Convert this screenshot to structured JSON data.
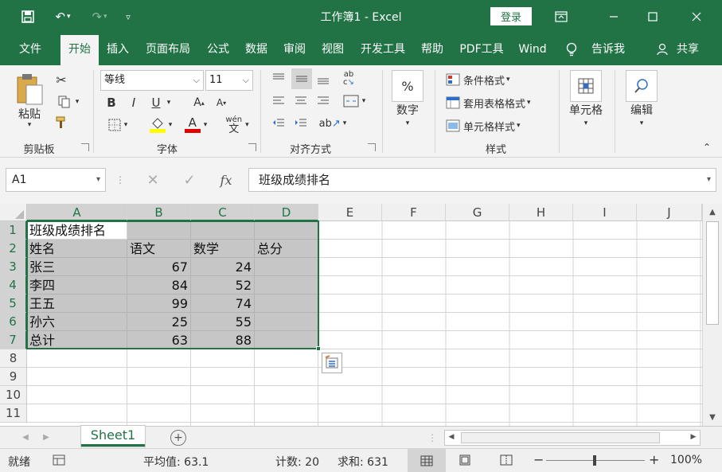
{
  "window": {
    "title": "工作簿1 - Excel",
    "login_label": "登录",
    "accent": "#217346"
  },
  "tabs": [
    {
      "label": "文件"
    },
    {
      "label": "开始",
      "active": true
    },
    {
      "label": "插入"
    },
    {
      "label": "页面布局"
    },
    {
      "label": "公式"
    },
    {
      "label": "数据"
    },
    {
      "label": "审阅"
    },
    {
      "label": "视图"
    },
    {
      "label": "开发工具"
    },
    {
      "label": "帮助"
    },
    {
      "label": "PDF工具"
    },
    {
      "label": "Wind"
    },
    {
      "label": "告诉我"
    },
    {
      "label": "共享"
    }
  ],
  "ribbon": {
    "clipboard": {
      "label": "剪贴板",
      "paste": "粘贴"
    },
    "font": {
      "label": "字体",
      "font_name": "等线",
      "font_size": "11",
      "bold": "B",
      "italic": "I",
      "underline": "U",
      "phonetic": "wén"
    },
    "alignment": {
      "label": "对齐方式"
    },
    "number": {
      "label": "数字",
      "symbol": "%"
    },
    "styles": {
      "label": "样式",
      "conditional": "条件格式",
      "table_format": "套用表格格式",
      "cell_styles": "单元格样式"
    },
    "cells": {
      "label": "单元格"
    },
    "editing": {
      "label": "编辑"
    }
  },
  "formula_bar": {
    "name_box": "A1",
    "fx": "fx",
    "content": "班级成绩排名"
  },
  "grid": {
    "columns": [
      "A",
      "B",
      "C",
      "D",
      "E",
      "F",
      "G",
      "H",
      "I",
      "J"
    ],
    "rows": [
      "1",
      "2",
      "3",
      "4",
      "5",
      "6",
      "7",
      "8",
      "9",
      "10",
      "11"
    ],
    "cells": [
      [
        "班级成绩排名",
        "",
        "",
        ""
      ],
      [
        "姓名",
        "语文",
        "数学",
        "总分"
      ],
      [
        "张三",
        "67",
        "24",
        ""
      ],
      [
        "李四",
        "84",
        "52",
        ""
      ],
      [
        "王五",
        "99",
        "74",
        ""
      ],
      [
        "孙六",
        "25",
        "55",
        ""
      ],
      [
        "总计",
        "63",
        "88",
        ""
      ]
    ],
    "selection": "A1:D7",
    "selection_fill": "#c6c6c6"
  },
  "sheets": [
    {
      "name": "Sheet1",
      "active": true
    }
  ],
  "status": {
    "ready": "就绪",
    "average": "平均值: 63.1",
    "count": "计数: 20",
    "sum": "求和: 631",
    "zoom": "100%"
  }
}
